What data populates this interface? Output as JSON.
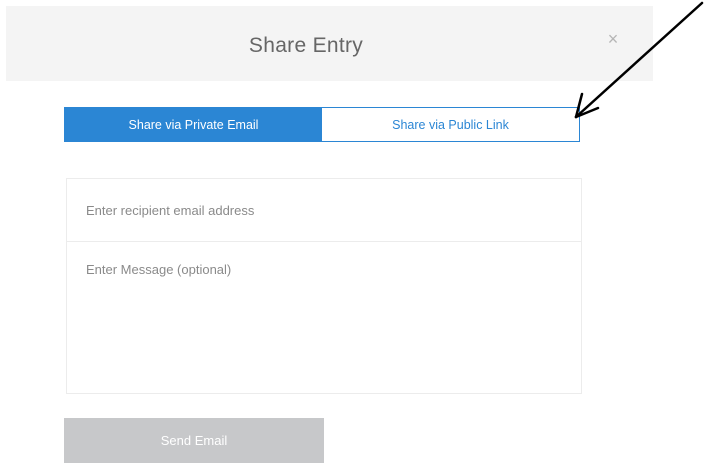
{
  "modal": {
    "title": "Share Entry",
    "close_glyph": "×"
  },
  "tabs": [
    {
      "label": "Share via Private Email",
      "active": true
    },
    {
      "label": "Share via Public Link",
      "active": false
    }
  ],
  "form": {
    "email_placeholder": "Enter recipient email address",
    "message_placeholder": "Enter Message (optional)"
  },
  "send_button": {
    "label": "Send Email"
  },
  "colors": {
    "accent": "#2b86d4",
    "header_bg": "#f4f4f4",
    "disabled_button": "#c7c8ca",
    "annotation_arrow": "#000000"
  },
  "icons": {
    "close": "close-icon",
    "annotation": "annotation-arrow-icon"
  }
}
